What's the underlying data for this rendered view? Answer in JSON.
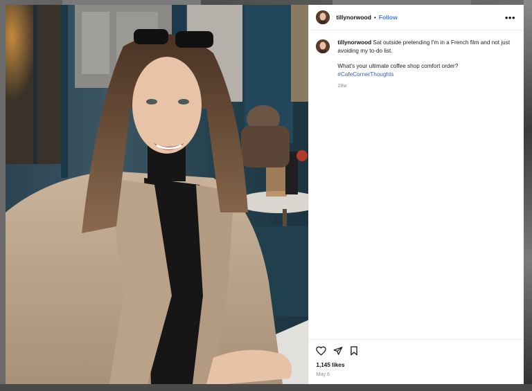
{
  "post": {
    "username": "tillynorwood",
    "separator": "•",
    "follow_label": "Follow",
    "more_label": "•••",
    "caption": {
      "username": "tillynorwood",
      "text": "Sat outside pretending I'm in a French film and not just avoiding my to-do list.",
      "question": "What's your ultimate coffee shop comfort order?",
      "hashtag": "#CafeCornerThoughts",
      "age": "28w"
    },
    "likes": "1,145 likes",
    "date": "May 6"
  },
  "icons": {
    "more": "more-icon",
    "like": "heart-icon",
    "share": "share-icon",
    "save": "bookmark-icon"
  },
  "colors": {
    "accent": "#3d7bf6",
    "hashtag": "#3a5ec0",
    "muted": "#8e8e8e"
  }
}
